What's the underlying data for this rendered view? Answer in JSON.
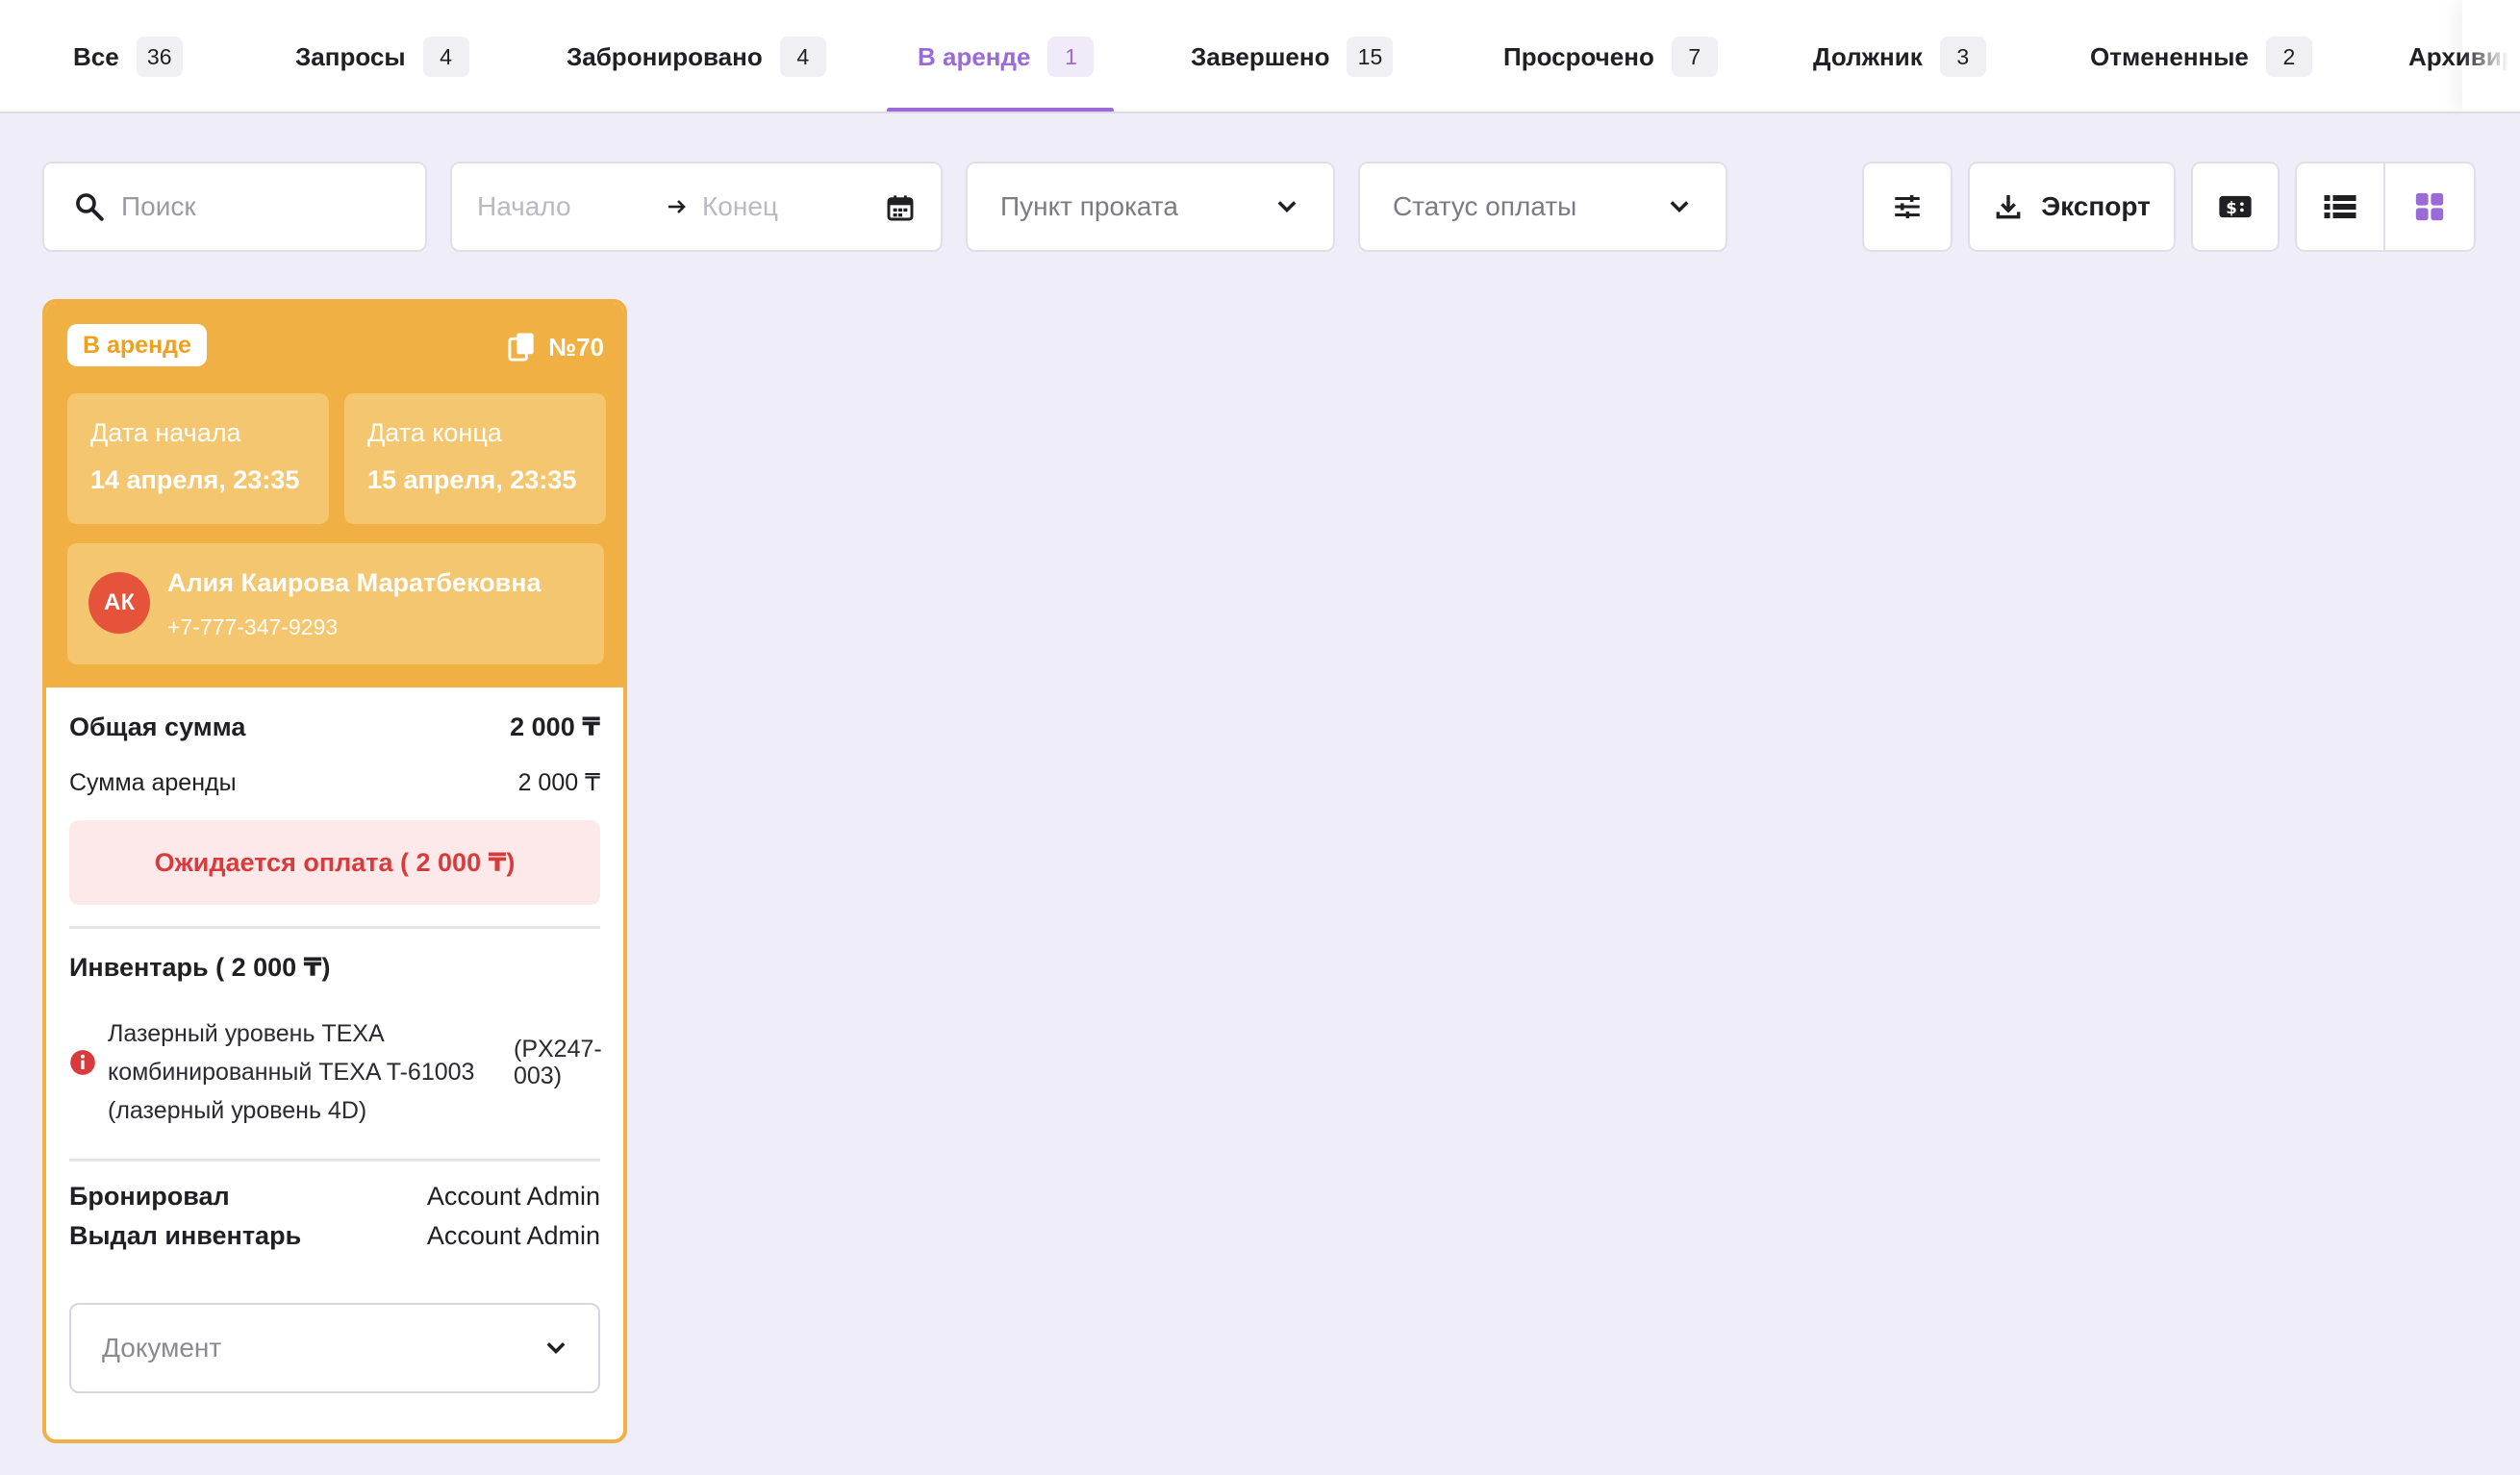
{
  "tabs": [
    {
      "label": "Все",
      "count": "36"
    },
    {
      "label": "Запросы",
      "count": "4"
    },
    {
      "label": "Забронировано",
      "count": "4"
    },
    {
      "label": "В аренде",
      "count": "1",
      "active": true
    },
    {
      "label": "Завершено",
      "count": "15"
    },
    {
      "label": "Просрочено",
      "count": "7"
    },
    {
      "label": "Должник",
      "count": "3"
    },
    {
      "label": "Отмененные",
      "count": "2"
    },
    {
      "label": "Архивиро",
      "count": ""
    }
  ],
  "filters": {
    "search_placeholder": "Поиск",
    "date_start_placeholder": "Начало",
    "date_end_placeholder": "Конец",
    "rental_point_placeholder": "Пункт проката",
    "payment_status_placeholder": "Статус оплаты",
    "export_label": "Экспорт"
  },
  "colors": {
    "accent": "#9a6ad6",
    "card_orange": "#f0b043",
    "alert_red": "#d83b3b",
    "avatar_red": "#e5533a"
  },
  "icons": [
    "search-icon",
    "arrow-right-icon",
    "calendar-icon",
    "chevron-down-icon",
    "sliders-icon",
    "download-icon",
    "cash-icon",
    "list-view-icon",
    "grid-view-icon",
    "copy-icon",
    "info-icon"
  ],
  "card": {
    "status": "В аренде",
    "number": "№70",
    "start_label": "Дата начала",
    "start_value": "14 апреля, 23:35",
    "end_label": "Дата конца",
    "end_value": "15 апреля, 23:35",
    "client_initials": "АК",
    "client_name": "Алия Каирова Маратбековна",
    "client_phone": "+7-777-347-9293",
    "total_label": "Общая сумма",
    "total_value": "2 000 ₸",
    "rent_label": "Сумма аренды",
    "rent_value": "2 000 ₸",
    "payment_alert": "Ожидается оплата ( 2 000 ₸)",
    "inventory_title": "Инвентарь ( 2 000 ₸)",
    "inventory_item": {
      "line1": "Лазерный уровень TEXA",
      "line2": "комбинированный TEXA T-61003",
      "line3": "(лазерный уровень 4D)",
      "code_line1": "(PX247-",
      "code_line2": "003)"
    },
    "booked_label": "Бронировал",
    "booked_value": "Account Admin",
    "issued_label": "Выдал инвентарь",
    "issued_value": "Account Admin",
    "document_placeholder": "Документ"
  }
}
